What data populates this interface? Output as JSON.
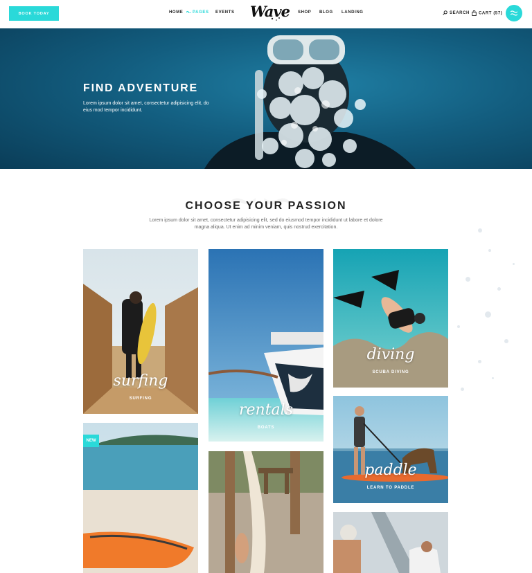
{
  "header": {
    "book_label": "BOOK TODAY",
    "nav_left": [
      {
        "label": "HOME",
        "active": false
      },
      {
        "label": "PAGES",
        "active": true
      },
      {
        "label": "EVENTS",
        "active": false
      }
    ],
    "logo": "Wave",
    "nav_right": [
      {
        "label": "SHOP"
      },
      {
        "label": "BLOG"
      },
      {
        "label": "LANDING"
      }
    ],
    "search_label": "SEARCH",
    "cart_label": "CART (57)",
    "accent_color": "#2ad9d9"
  },
  "hero": {
    "title": "FIND ADVENTURE",
    "text": "Lorem ipsum dolor sit amet, consectetur adipisicing elit, do eius mod tempor incididunt."
  },
  "passion": {
    "title": "CHOOSE YOUR PASSION",
    "text": "Lorem ipsum dolor sit amet, consectetur adipisicing elit, sed do eiusmod tempor incididunt ut labore et dolore magna aliqua. Ut enim ad minim veniam, quis nostrud exercitation."
  },
  "cards": [
    {
      "script": "surfing",
      "label": "SURFING"
    },
    {
      "script": "rentals",
      "label": "BOATS"
    },
    {
      "script": "diving",
      "label": "SCUBA DIVING"
    },
    {
      "script": "paddle",
      "label": "LEARN TO PADDLE"
    },
    {
      "badge": "NEW"
    }
  ]
}
